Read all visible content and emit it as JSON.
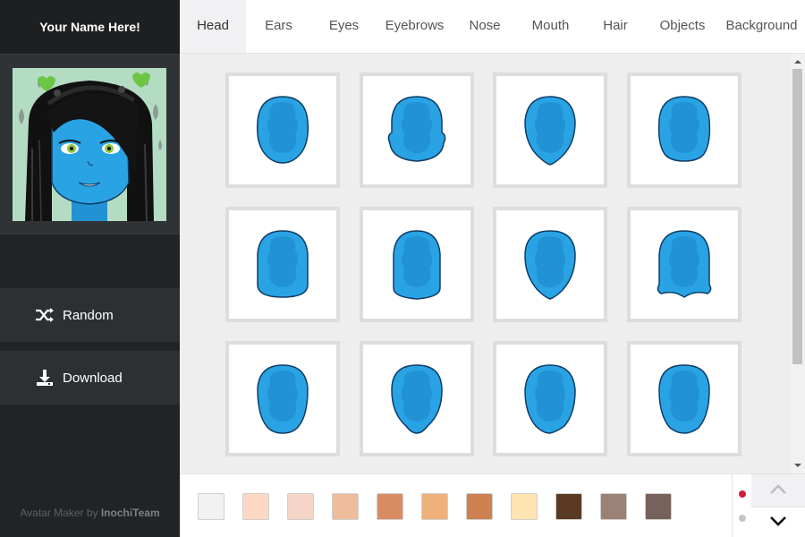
{
  "sidebar": {
    "name_title": "Your Name Here!",
    "random_label": "Random",
    "download_label": "Download",
    "credit_prefix": "Avatar Maker by ",
    "credit_brand": "InochiTeam"
  },
  "tabs": [
    {
      "label": "Head",
      "active": true
    },
    {
      "label": "Ears"
    },
    {
      "label": "Eyes"
    },
    {
      "label": "Eyebrows"
    },
    {
      "label": "Nose"
    },
    {
      "label": "Mouth"
    },
    {
      "label": "Hair"
    },
    {
      "label": "Objects"
    },
    {
      "label": "Background"
    }
  ],
  "head_options": [
    {
      "icon": "head-shape-oval-icon"
    },
    {
      "icon": "head-shape-wide-jowl-icon"
    },
    {
      "icon": "head-shape-pointed-chin-icon"
    },
    {
      "icon": "head-shape-round-chin-icon"
    },
    {
      "icon": "head-shape-square-icon"
    },
    {
      "icon": "head-shape-rect-icon"
    },
    {
      "icon": "head-shape-v-chin-icon"
    },
    {
      "icon": "head-shape-notched-icon"
    },
    {
      "icon": "head-shape-flat-chin-icon"
    },
    {
      "icon": "head-shape-heart-icon"
    },
    {
      "icon": "head-shape-long-icon"
    },
    {
      "icon": "head-shape-soft-icon"
    }
  ],
  "skin_colors": [
    "#f2f2f2",
    "#fcd8c4",
    "#f5d5c7",
    "#eebb9b",
    "#d98c63",
    "#eeb17a",
    "#ce8050",
    "#fde4b1",
    "#5b3a23",
    "#9b8176",
    "#76625b"
  ],
  "colors": {
    "head_fill": "#2aa3e4",
    "head_inner": "#2193d5",
    "head_stroke": "#0e3d66",
    "active_dot": "#cf1d3a",
    "inactive_dot": "#c4c4cc"
  }
}
